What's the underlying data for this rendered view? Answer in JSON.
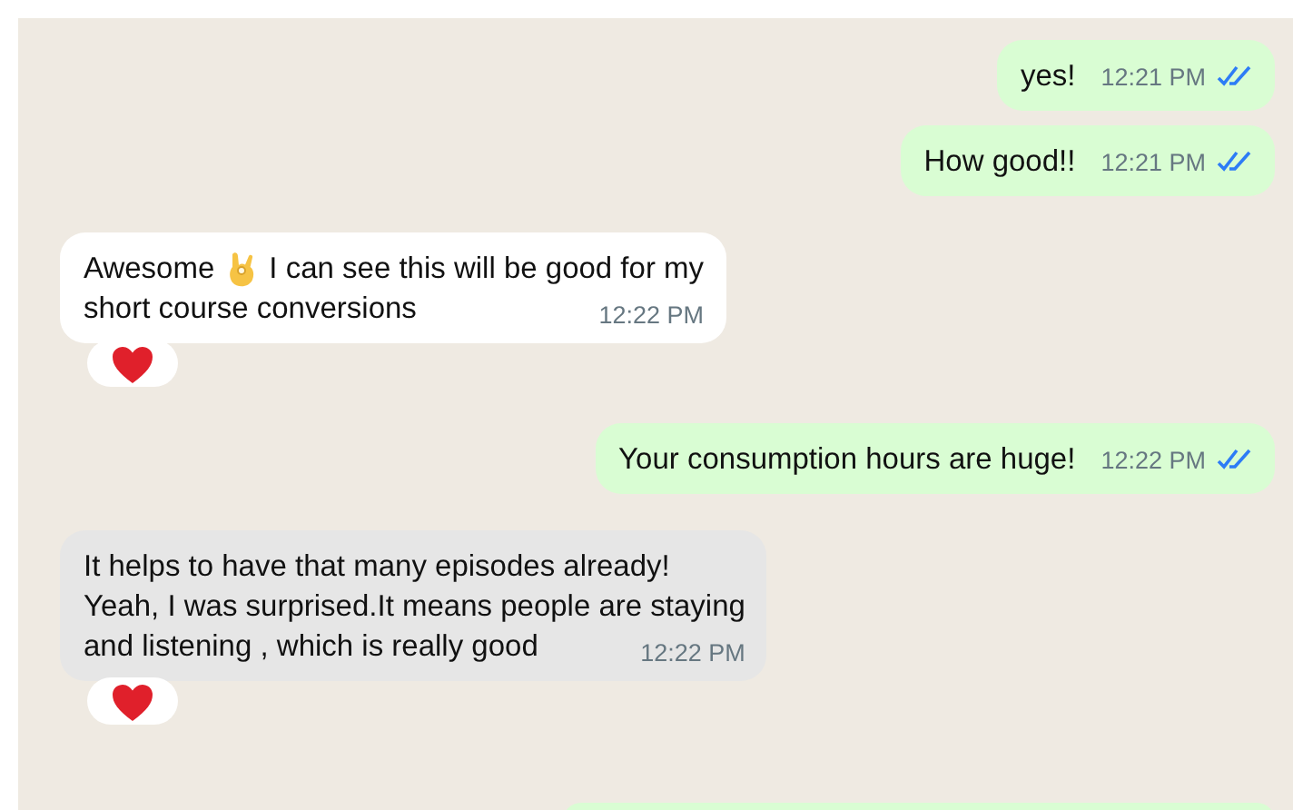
{
  "messages": [
    {
      "kind": "message",
      "outgoing": true,
      "lines": [
        {
          "text": "yes!"
        }
      ],
      "time": "12:21 PM",
      "read": true,
      "highlighted": false
    },
    {
      "kind": "message",
      "outgoing": true,
      "lines": [
        {
          "text": "How good!!"
        }
      ],
      "time": "12:21 PM",
      "read": true,
      "highlighted": false
    },
    {
      "kind": "message",
      "outgoing": false,
      "lines": [
        {
          "text_before_emoji": "Awesome",
          "text": "I can see this will be good for my"
        },
        {
          "text": "short course conversions"
        }
      ],
      "time": "12:22 PM",
      "highlighted": false,
      "heart_reaction": true
    },
    {
      "kind": "message",
      "outgoing": true,
      "lines": [
        {
          "text": "Your consumption hours are huge!"
        }
      ],
      "time": "12:22 PM",
      "read": true,
      "highlighted": false
    },
    {
      "kind": "message",
      "outgoing": false,
      "lines": [
        {
          "text": "It helps to have that many episodes already!"
        },
        {
          "text": "Yeah, I was surprised.It means people are staying"
        },
        {
          "text": "and listening , which is really good"
        }
      ],
      "time": "12:22 PM",
      "highlighted": true,
      "heart_reaction": true
    },
    {
      "kind": "partial",
      "outgoing": true
    }
  ]
}
